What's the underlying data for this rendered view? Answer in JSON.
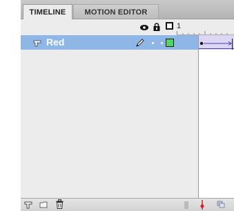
{
  "tabs": [
    {
      "label": "TIMELINE",
      "active": true
    },
    {
      "label": "MOTION EDITOR",
      "active": false
    }
  ],
  "header": {
    "frame_number": "1",
    "icons": [
      "eye-icon",
      "lock-icon",
      "outline-icon"
    ]
  },
  "layers": [
    {
      "name": "Red",
      "selected": true,
      "color": "#4cd867"
    }
  ],
  "bottom_toolbar": {
    "icons": [
      "new-layer-icon",
      "new-folder-icon",
      "trash-icon",
      "scroll-grip-icon",
      "playhead-marker-icon",
      "onion-skin-icon"
    ]
  },
  "colors": {
    "selection": "#8eb7e8",
    "panel_bg": "#ececec",
    "keyframe_bg": "#dcd5f4",
    "tween_arrow": "#4b3fa8"
  }
}
